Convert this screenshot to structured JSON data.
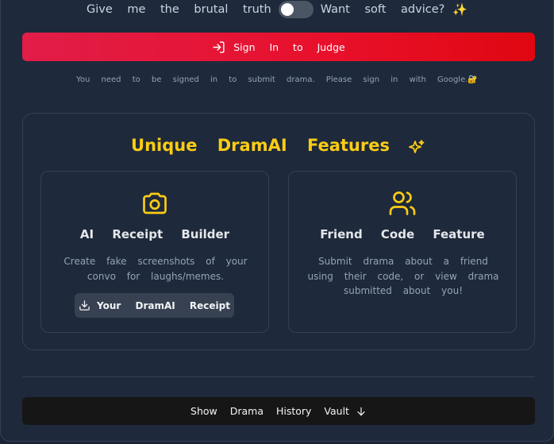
{
  "mode": {
    "left_label": "Give me the brutal truth",
    "right_label": "Want soft advice?",
    "sparkle": "✨",
    "toggle_on": false
  },
  "signin": {
    "label": "Sign In to Judge",
    "icon": "login-icon",
    "hint": "You need to be signed in to submit drama. Please sign in with Google.🔐"
  },
  "features": {
    "title": "Unique DramAI Features",
    "title_icon": "sparkles-icon",
    "cards": [
      {
        "icon": "camera-icon",
        "title": "AI Receipt Builder",
        "description": "Create fake screenshots of your convo for laughs/memes.",
        "button_label": "Your DramAI Receipt",
        "button_icon": "download-icon"
      },
      {
        "icon": "users-icon",
        "title": "Friend Code Feature",
        "description": "Submit drama about a friend using their code, or view drama submitted about you!"
      }
    ]
  },
  "history": {
    "label": "Show Drama History Vault",
    "icon": "arrow-down-icon"
  },
  "colors": {
    "background": "#1e293b",
    "accent_yellow": "#facc15",
    "signin_red": "#e11d48",
    "history_bg": "#161616"
  }
}
